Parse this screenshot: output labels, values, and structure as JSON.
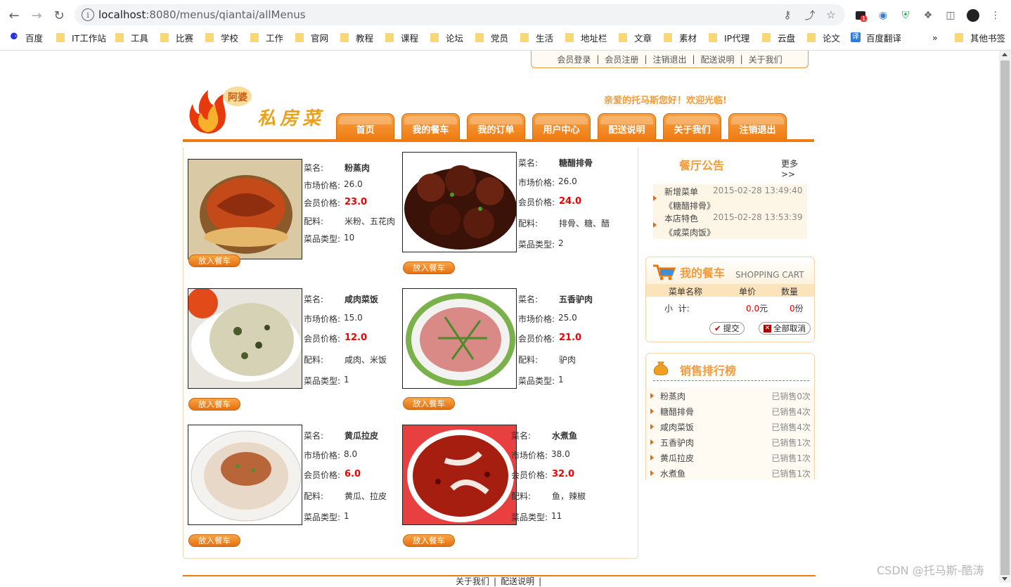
{
  "browser": {
    "url_host": "localhost",
    "url_path": ":8080/menus/qiantai/allMenus",
    "ext_badge": "1",
    "bookmarks": [
      "百度",
      "IT工作站",
      "工具",
      "比赛",
      "学校",
      "工作",
      "官网",
      "教程",
      "课程",
      "论坛",
      "党员",
      "生活",
      "地址栏",
      "文章",
      "素材",
      "IP代理",
      "云盘",
      "论文",
      "百度翻译"
    ],
    "more": "»",
    "other_bookmarks": "其他书签"
  },
  "header": {
    "top_links": [
      "会员登录",
      "会员注册",
      "注销退出",
      "配送说明",
      "关于我们"
    ],
    "separator": "|",
    "logo_badge": "阿婆",
    "logo_text": "私房菜",
    "welcome": "亲爱的托马斯您好！欢迎光临!",
    "nav": [
      "首页",
      "我的餐车",
      "我的订单",
      "用户中心",
      "配送说明",
      "关于我们",
      "注销退出"
    ]
  },
  "labels": {
    "name": "菜名:",
    "market": "市场价格:",
    "member": "会员价格:",
    "ingredients": "配料:",
    "type": "菜品类型:",
    "add_cart": "放入餐车"
  },
  "dishes": [
    {
      "name": "粉蒸肉",
      "market": "26.0",
      "member": "23.0",
      "ingredients": "米粉、五花肉",
      "type": "10"
    },
    {
      "name": "糖醋排骨",
      "market": "26.0",
      "member": "24.0",
      "ingredients": "排骨、糖、醋",
      "type": "2"
    },
    {
      "name": "咸肉菜饭",
      "market": "15.0",
      "member": "12.0",
      "ingredients": "咸肉、米饭",
      "type": "1"
    },
    {
      "name": "五香驴肉",
      "market": "25.0",
      "member": "21.0",
      "ingredients": "驴肉",
      "type": "1"
    },
    {
      "name": "黄瓜拉皮",
      "market": "8.0",
      "member": "6.0",
      "ingredients": "黄瓜、拉皮",
      "type": "1"
    },
    {
      "name": "水煮鱼",
      "market": "38.0",
      "member": "32.0",
      "ingredients": "鱼，辣椒",
      "type": "11"
    }
  ],
  "notice": {
    "title": "餐厅公告",
    "more": "更多>>",
    "items": [
      {
        "title": "新增菜单",
        "date": "2015-02-28 13:49:40",
        "sub": "《糖醋排骨》"
      },
      {
        "title": "本店特色",
        "date": "2015-02-28 13:53:39",
        "sub": "《咸菜肉饭》"
      }
    ]
  },
  "cart": {
    "title": "我的餐车",
    "subtitle": "SHOPPING CART",
    "col_name": "菜单名称",
    "col_price": "单价",
    "col_qty": "数量",
    "subtotal_label": "小  计:",
    "subtotal_price": "0.0",
    "price_unit": "元",
    "subtotal_qty": "0",
    "qty_unit": "份",
    "submit": "提交",
    "cancel_all": "全部取消"
  },
  "rank": {
    "title": "销售排行榜",
    "items": [
      {
        "name": "粉蒸肉",
        "sold": "已销售0次"
      },
      {
        "name": "糖醋排骨",
        "sold": "已销售4次"
      },
      {
        "name": "咸肉菜饭",
        "sold": "已销售4次"
      },
      {
        "name": "五香驴肉",
        "sold": "已销售1次"
      },
      {
        "name": "黄瓜拉皮",
        "sold": "已销售1次"
      },
      {
        "name": "水煮鱼",
        "sold": "已销售1次"
      }
    ]
  },
  "footer": {
    "links": [
      "关于我们",
      "配送说明"
    ]
  },
  "watermark": "CSDN @托马斯-酷涛",
  "colors": {
    "accent": "#ef7c12",
    "title": "#f39b3a",
    "price_red": "#e00000"
  }
}
